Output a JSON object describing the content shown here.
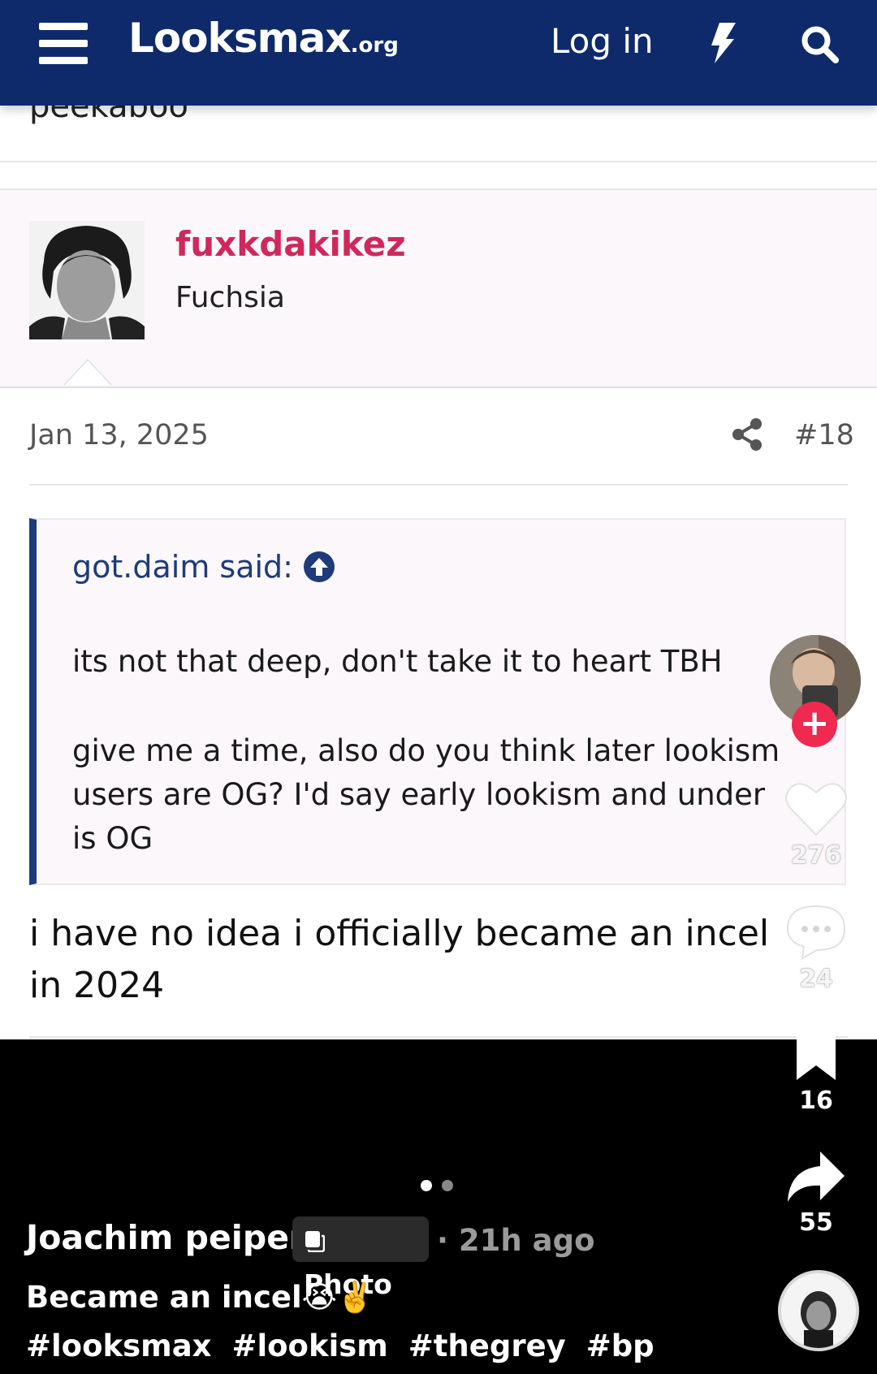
{
  "header": {
    "logo_main": "Looksmax",
    "logo_suffix": ".org",
    "login_label": "Log in"
  },
  "previous_post": {
    "text_fragment": "peekaboo"
  },
  "post": {
    "username": "fuxkdakikez",
    "user_title": "Fuchsia",
    "date": "Jan 13, 2025",
    "post_number": "#18",
    "quote": {
      "attribution": "got.daim said:",
      "paragraph_1": "its not that deep, don't take it to heart TBH",
      "paragraph_2": "give me a time, also do you think later lookism users are OG? I'd say early lookism and under is OG"
    },
    "reply": "i have no idea i officially became an incel in 2024"
  },
  "video_overlay": {
    "author": "Joachim peiper",
    "chip_label": "Photo",
    "time_ago": "· 21h ago",
    "caption": "Became an incel😭✌️",
    "hashtags": [
      "#looksmax",
      "#lookism",
      "#thegrey",
      "#bp"
    ],
    "carousel": {
      "total": 2,
      "active_index": 0
    },
    "actions": {
      "likes": "276",
      "comments": "24",
      "saves": "16",
      "shares": "55"
    }
  },
  "colors": {
    "header_bg": "#0e2a6b",
    "username": "#d1285c",
    "quote_border": "#1e3b7a",
    "follow_button": "#ef2950"
  },
  "icons": [
    "menu-icon",
    "bolt-icon",
    "search-icon",
    "share-icon",
    "arrow-up-icon",
    "heart-icon",
    "comment-icon",
    "bookmark-icon",
    "forward-icon",
    "photo-icon"
  ]
}
